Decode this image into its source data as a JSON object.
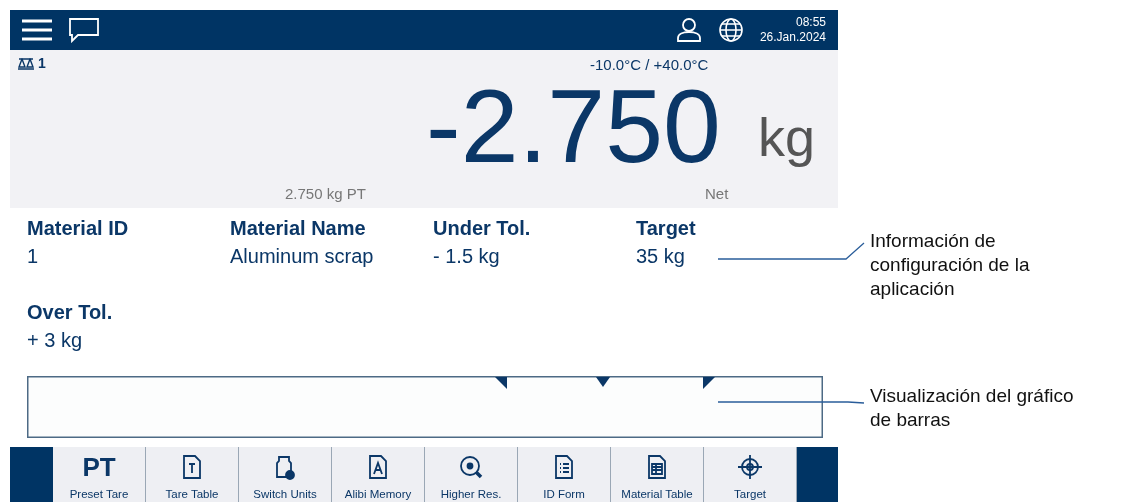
{
  "header": {
    "time": "08:55",
    "date": "26.Jan.2024"
  },
  "scale": {
    "number": "1",
    "temp_range": "-10.0°C / +40.0°C",
    "weight": "-2.750",
    "unit": "kg",
    "tare": "2.750 kg PT",
    "mode": "Net"
  },
  "fields": [
    {
      "label": "Material ID",
      "value": "1"
    },
    {
      "label": "Material Name",
      "value": "Aluminum scrap"
    },
    {
      "label": "Under Tol.",
      "value": "- 1.5 kg"
    },
    {
      "label": "Target",
      "value": "35 kg"
    },
    {
      "label": "Over Tol.",
      "value": "+ 3 kg"
    }
  ],
  "softkeys": [
    {
      "kind": "text",
      "glyph": "PT",
      "label": "Preset Tare"
    },
    {
      "kind": "icon",
      "label": "Tare Table"
    },
    {
      "kind": "icon",
      "label": "Switch Units"
    },
    {
      "kind": "icon",
      "label": "Alibi Memory"
    },
    {
      "kind": "icon",
      "label": "Higher Res."
    },
    {
      "kind": "icon",
      "label": "ID Form"
    },
    {
      "kind": "icon",
      "label": "Material Table"
    },
    {
      "kind": "icon",
      "label": "Target"
    }
  ],
  "annotations": [
    "Información de configuración de la aplicación",
    "Visualización del gráfico de barras"
  ]
}
